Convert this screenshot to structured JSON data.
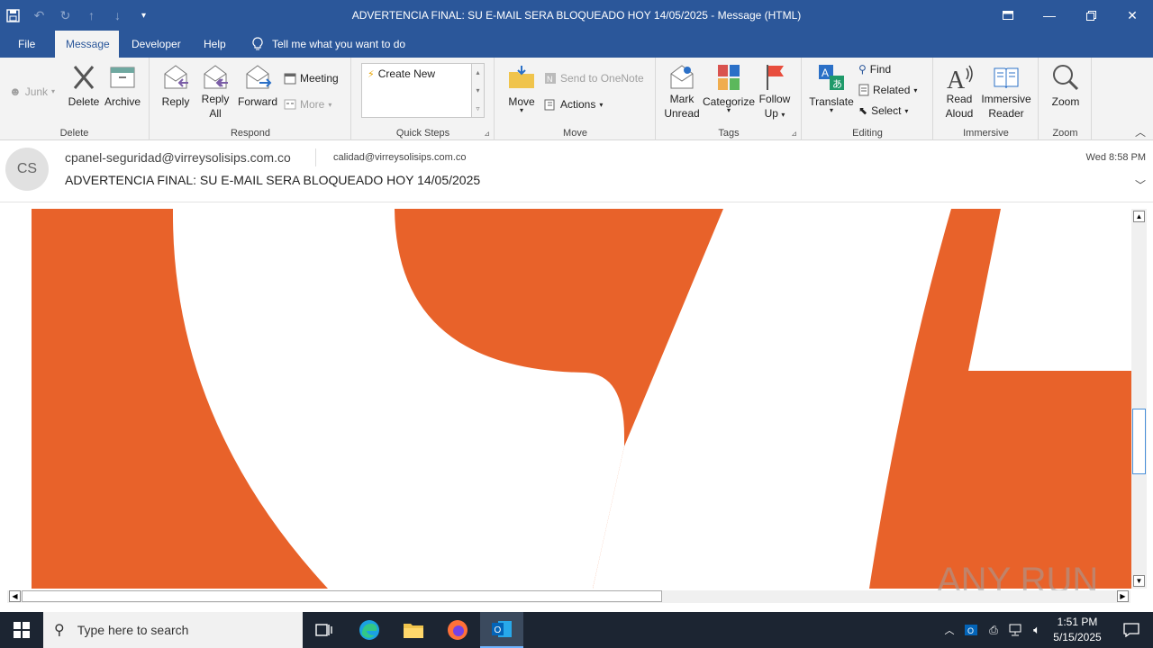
{
  "window": {
    "title": "ADVERTENCIA FINAL: SU E-MAIL SERA BLOQUEADO HOY 14/05/2025  -  Message (HTML)",
    "quick_access": [
      "save-icon",
      "undo-icon",
      "redo-icon",
      "up-arrow-icon",
      "down-arrow-icon",
      "customize-icon"
    ]
  },
  "menu": {
    "file": "File",
    "message": "Message",
    "developer": "Developer",
    "help": "Help",
    "tell_me": "Tell me what you want to do"
  },
  "ribbon": {
    "delete_group": {
      "label": "Delete",
      "junk": "Junk",
      "delete": "Delete",
      "archive": "Archive"
    },
    "respond_group": {
      "label": "Respond",
      "reply": "Reply",
      "reply_all_1": "Reply",
      "reply_all_2": "All",
      "forward": "Forward",
      "meeting": "Meeting",
      "more": "More"
    },
    "quicksteps_group": {
      "label": "Quick Steps",
      "create_new": "Create New"
    },
    "move_group": {
      "label": "Move",
      "move": "Move",
      "send_onenote": "Send to OneNote",
      "actions": "Actions"
    },
    "tags_group": {
      "label": "Tags",
      "mark_unread_1": "Mark",
      "mark_unread_2": "Unread",
      "categorize": "Categorize",
      "follow_up_1": "Follow",
      "follow_up_2": "Up"
    },
    "editing_group": {
      "label": "Editing",
      "translate": "Translate",
      "find": "Find",
      "related": "Related",
      "select": "Select"
    },
    "immersive_group": {
      "label": "Immersive",
      "read_aloud_1": "Read",
      "read_aloud_2": "Aloud",
      "immersive_reader_1": "Immersive",
      "immersive_reader_2": "Reader"
    },
    "zoom_group": {
      "label": "Zoom",
      "zoom": "Zoom"
    }
  },
  "message": {
    "avatar_initials": "CS",
    "from": "cpanel-seguridad@virreysolisips.com.co",
    "to": "calidad@virreysolisips.com.co",
    "subject": "ADVERTENCIA FINAL: SU E-MAIL SERA BLOQUEADO HOY 14/05/2025",
    "date": "Wed 8:58 PM",
    "body_image_color": "#e8622a"
  },
  "watermark": "ANY RUN",
  "taskbar": {
    "search_placeholder": "Type here to search",
    "time": "1:51 PM",
    "date": "5/15/2025"
  },
  "colors": {
    "accent": "#2b579a",
    "ribbon_bg": "#f3f3f3",
    "taskbar_bg": "#1c2532"
  }
}
